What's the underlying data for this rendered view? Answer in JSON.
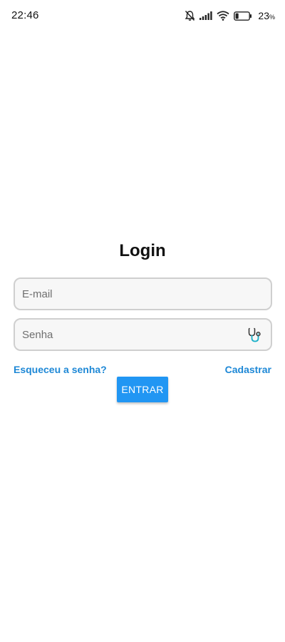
{
  "status_bar": {
    "time": "22:46",
    "icons": [
      "bell-muted-icon",
      "signal-icon",
      "wifi-icon",
      "battery-icon"
    ],
    "battery_value": "23",
    "battery_unit": "%",
    "battery_level": 0.23
  },
  "login": {
    "title": "Login",
    "email_placeholder": "E-mail",
    "email_value": "",
    "password_placeholder": "Senha",
    "password_value": "",
    "password_icon": "stethoscope-icon",
    "forgot_label": "Esqueceu a senha?",
    "register_label": "Cadastrar",
    "enter_label": "ENTRAR"
  },
  "colors": {
    "accent": "#2196f3",
    "link": "#1e88d6",
    "field_border": "#cfcfcf",
    "field_bg": "#f7f7f7",
    "icon_teal": "#1ab0c8"
  }
}
